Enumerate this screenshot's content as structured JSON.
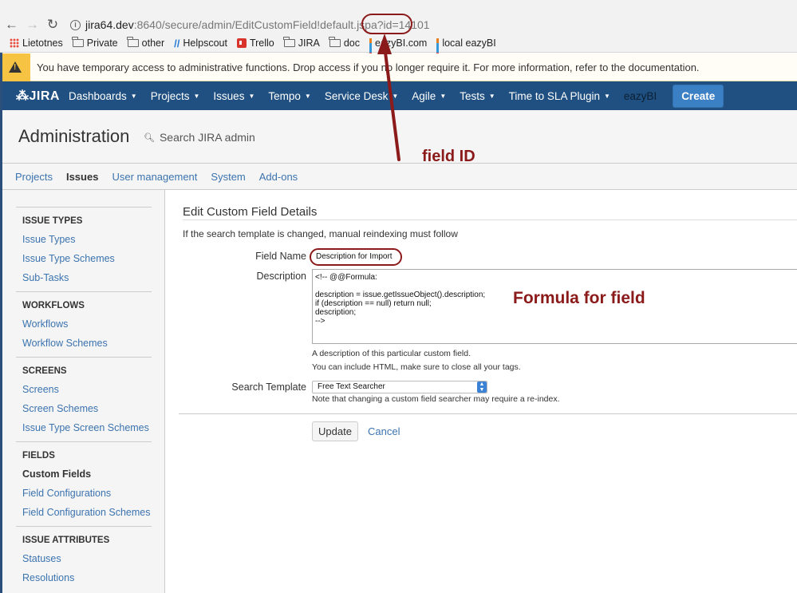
{
  "browser": {
    "url_host": "jira64.dev",
    "url_path": ":8640/secure/admin/EditCustomField!default.jspa?id=",
    "url_id": "14101",
    "bookmarks": [
      {
        "label": "Lietotnes",
        "icon": "apps-grid-icon"
      },
      {
        "label": "Private",
        "icon": "folder-icon"
      },
      {
        "label": "other",
        "icon": "folder-icon"
      },
      {
        "label": "Helpscout",
        "icon": "helpscout-icon"
      },
      {
        "label": "Trello",
        "icon": "trello-icon"
      },
      {
        "label": "JIRA",
        "icon": "folder-icon"
      },
      {
        "label": "doc",
        "icon": "folder-icon"
      },
      {
        "label": "eazyBI.com",
        "icon": "bar-chart-icon"
      },
      {
        "label": "local eazyBI",
        "icon": "bar-chart-icon"
      }
    ]
  },
  "warning": {
    "text_before": "You have temporary access to administrative functions.",
    "drop_link": "Drop access",
    "text_middle": "if you no longer require it. For more information, refer to the",
    "doc_link": "documentation",
    "text_end": "."
  },
  "header": {
    "logo": "JIRA",
    "menu": [
      {
        "label": "Dashboards",
        "caret": true
      },
      {
        "label": "Projects",
        "caret": true
      },
      {
        "label": "Issues",
        "caret": true
      },
      {
        "label": "Tempo",
        "caret": true
      },
      {
        "label": "Service Desk",
        "caret": true
      },
      {
        "label": "Agile",
        "caret": true
      },
      {
        "label": "Tests",
        "caret": true
      },
      {
        "label": "Time to SLA Plugin",
        "caret": true
      }
    ],
    "eazybi": "eazyBI",
    "create": "Create"
  },
  "admin": {
    "title": "Administration",
    "search_placeholder": "Search JIRA admin",
    "tabs": [
      {
        "label": "Projects",
        "active": false
      },
      {
        "label": "Issues",
        "active": true
      },
      {
        "label": "User management",
        "active": false
      },
      {
        "label": "System",
        "active": false
      },
      {
        "label": "Add-ons",
        "active": false
      }
    ]
  },
  "sidebar": {
    "groups": [
      {
        "heading": "ISSUE TYPES",
        "items": [
          "Issue Types",
          "Issue Type Schemes",
          "Sub-Tasks"
        ]
      },
      {
        "heading": "WORKFLOWS",
        "items": [
          "Workflows",
          "Workflow Schemes"
        ]
      },
      {
        "heading": "SCREENS",
        "items": [
          "Screens",
          "Screen Schemes",
          "Issue Type Screen Schemes"
        ]
      },
      {
        "heading": "FIELDS",
        "items": [
          "Custom Fields",
          "Field Configurations",
          "Field Configuration Schemes"
        ],
        "active_item": "Custom Fields"
      },
      {
        "heading": "ISSUE ATTRIBUTES",
        "items": [
          "Statuses",
          "Resolutions"
        ]
      }
    ]
  },
  "form": {
    "title": "Edit Custom Field Details",
    "note": "If the search template is changed, manual reindexing must follow",
    "field_name_label": "Field Name",
    "field_name_value": "Description for Import",
    "description_label": "Description",
    "description_value": "<!-- @@Formula:\n\ndescription = issue.getIssueObject().description;\nif (description == null) return null;\ndescription;\n-->",
    "help1": "A description of this particular custom field.",
    "help2": "You can include HTML, make sure to close all your tags.",
    "search_template_label": "Search Template",
    "search_template_value": "Free Text Searcher",
    "select_note_before": "Note that changing a custom field searcher may require a",
    "select_note_link": "re-index",
    "select_note_end": ".",
    "update": "Update",
    "cancel": "Cancel"
  },
  "annotations": {
    "field_id": "field ID",
    "formula": "Formula for field",
    "color": "#8b1a1a"
  }
}
